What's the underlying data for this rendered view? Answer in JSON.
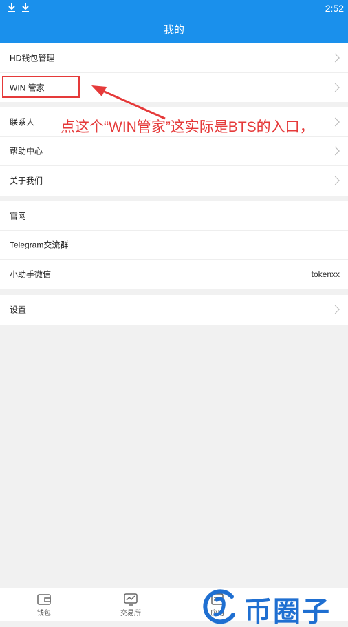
{
  "status_bar": {
    "time": "2:52"
  },
  "header": {
    "title": "我的"
  },
  "group1": [
    {
      "label": "HD钱包管理"
    },
    {
      "label": "WIN 管家"
    }
  ],
  "group2": [
    {
      "label": "联系人"
    },
    {
      "label": "帮助中心"
    },
    {
      "label": "关于我们"
    }
  ],
  "group3": [
    {
      "label": "官网"
    },
    {
      "label": "Telegram交流群"
    },
    {
      "label": "小助手微信",
      "value": "tokenxx"
    }
  ],
  "group4": [
    {
      "label": "设置"
    }
  ],
  "annotation": {
    "text": "点这个“WIN管家”这实际是BTS的入口，",
    "color": "#e53a3a"
  },
  "tabs": [
    {
      "label": "钱包",
      "icon": "wallet-icon"
    },
    {
      "label": "交易所",
      "icon": "chart-monitor-icon"
    },
    {
      "label": "应用",
      "icon": "apps-icon"
    }
  ],
  "watermark": {
    "text": "币圈子"
  },
  "colors": {
    "primary": "#1a90ec",
    "annotation": "#e53a3a",
    "watermark": "#1f6fd1"
  }
}
